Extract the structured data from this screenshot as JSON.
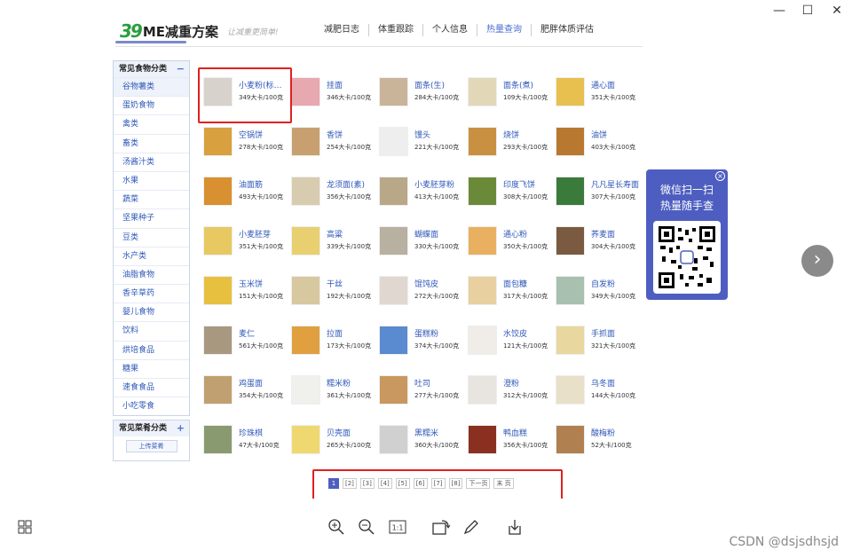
{
  "window": {
    "minimize": "—",
    "maximize": "☐",
    "close": "✕"
  },
  "header": {
    "logo_num": "39",
    "logo_name": "ME减重方案",
    "slogan": "让减重更简单!",
    "nav": [
      "减肥日志",
      "体重跟踪",
      "个人信息",
      "热量查询",
      "肥胖体质评估"
    ],
    "active_nav": "热量查询"
  },
  "sidebar": {
    "section1_title": "常见食物分类",
    "section1_toggle": "−",
    "categories": [
      "谷物薯类",
      "蛋奶食物",
      "禽类",
      "畜类",
      "汤酱汁类",
      "水果",
      "蔬菜",
      "坚果种子",
      "豆类",
      "水产类",
      "油脂食物",
      "香辛草药",
      "婴儿食物",
      "饮料",
      "烘培食品",
      "糖果",
      "速食食品",
      "小吃零食"
    ],
    "section2_title": "常见菜肴分类",
    "section2_toggle": "+",
    "upload_label": "上传菜肴"
  },
  "foods": [
    {
      "name": "小麦粉(标…",
      "cal": "349大卡/100克",
      "color": "#d8d2cc"
    },
    {
      "name": "挂面",
      "cal": "346大卡/100克",
      "color": "#e8a8b0"
    },
    {
      "name": "面条(生)",
      "cal": "284大卡/100克",
      "color": "#c9b49a"
    },
    {
      "name": "面条(煮)",
      "cal": "109大卡/100克",
      "color": "#e2d8b8"
    },
    {
      "name": "通心面",
      "cal": "351大卡/100克",
      "color": "#e8c050"
    },
    {
      "name": "空锅饼",
      "cal": "278大卡/100克",
      "color": "#d9a040"
    },
    {
      "name": "香饼",
      "cal": "254大卡/100克",
      "color": "#c8a070"
    },
    {
      "name": "馒头",
      "cal": "221大卡/100克",
      "color": "#eeeeee"
    },
    {
      "name": "烧饼",
      "cal": "293大卡/100克",
      "color": "#c89040"
    },
    {
      "name": "油饼",
      "cal": "403大卡/100克",
      "color": "#b87830"
    },
    {
      "name": "油面筋",
      "cal": "493大卡/100克",
      "color": "#d89030"
    },
    {
      "name": "龙须面(素)",
      "cal": "356大卡/100克",
      "color": "#d8ccb0"
    },
    {
      "name": "小麦胚芽粉",
      "cal": "413大卡/100克",
      "color": "#b8a888"
    },
    {
      "name": "印度飞饼",
      "cal": "308大卡/100克",
      "color": "#6a8a3a"
    },
    {
      "name": "凡凡星长寿面",
      "cal": "307大卡/100克",
      "color": "#3a7a3a"
    },
    {
      "name": "小麦胚芽",
      "cal": "351大卡/100克",
      "color": "#e8c860"
    },
    {
      "name": "高粱",
      "cal": "339大卡/100克",
      "color": "#e8d070"
    },
    {
      "name": "蝴蝶面",
      "cal": "330大卡/100克",
      "color": "#b8b0a0"
    },
    {
      "name": "通心粉",
      "cal": "350大卡/100克",
      "color": "#e8b060"
    },
    {
      "name": "荞麦面",
      "cal": "304大卡/100克",
      "color": "#7a5a40"
    },
    {
      "name": "玉米饼",
      "cal": "151大卡/100克",
      "color": "#e8c040"
    },
    {
      "name": "干丝",
      "cal": "192大卡/100克",
      "color": "#d8c8a0"
    },
    {
      "name": "馄饨皮",
      "cal": "272大卡/100克",
      "color": "#e0d8d0"
    },
    {
      "name": "面包糠",
      "cal": "317大卡/100克",
      "color": "#e8d0a0"
    },
    {
      "name": "自发粉",
      "cal": "349大卡/100克",
      "color": "#a8c0b0"
    },
    {
      "name": "麦仁",
      "cal": "561大卡/100克",
      "color": "#a89880"
    },
    {
      "name": "拉面",
      "cal": "173大卡/100克",
      "color": "#e0a040"
    },
    {
      "name": "蛋糕粉",
      "cal": "374大卡/100克",
      "color": "#5a8ad0"
    },
    {
      "name": "水饺皮",
      "cal": "121大卡/100克",
      "color": "#f0ece8"
    },
    {
      "name": "手抓面",
      "cal": "321大卡/100克",
      "color": "#e8d8a0"
    },
    {
      "name": "鸡蛋面",
      "cal": "354大卡/100克",
      "color": "#c0a070"
    },
    {
      "name": "糯米粉",
      "cal": "361大卡/100克",
      "color": "#f0f0ec"
    },
    {
      "name": "吐司",
      "cal": "277大卡/100克",
      "color": "#c89860"
    },
    {
      "name": "澄粉",
      "cal": "312大卡/100克",
      "color": "#e8e4e0"
    },
    {
      "name": "乌冬面",
      "cal": "144大卡/100克",
      "color": "#e8e0c8"
    },
    {
      "name": "珍珠棋",
      "cal": "47大卡/100克",
      "color": "#8a9a70"
    },
    {
      "name": "贝壳面",
      "cal": "265大卡/100克",
      "color": "#f0d870"
    },
    {
      "name": "黑糯米",
      "cal": "360大卡/100克",
      "color": "#d0d0d0"
    },
    {
      "name": "鸭血糕",
      "cal": "356大卡/100克",
      "color": "#8a3020"
    },
    {
      "name": "酸梅粉",
      "cal": "52大卡/100克",
      "color": "#b08050"
    }
  ],
  "qr_popup": {
    "line1": "微信扫一扫",
    "line2": "热量随手查",
    "close": "×"
  },
  "pagination": {
    "pages": [
      "1",
      "[2]",
      "[3]",
      "[4]",
      "[5]",
      "[6]",
      "[7]",
      "[8]"
    ],
    "active": "1",
    "next": "下一页",
    "last": "末 页"
  },
  "viewer_toolbar": {
    "next_arrow": "›"
  },
  "watermark": "CSDN @dsjsdhsjd"
}
